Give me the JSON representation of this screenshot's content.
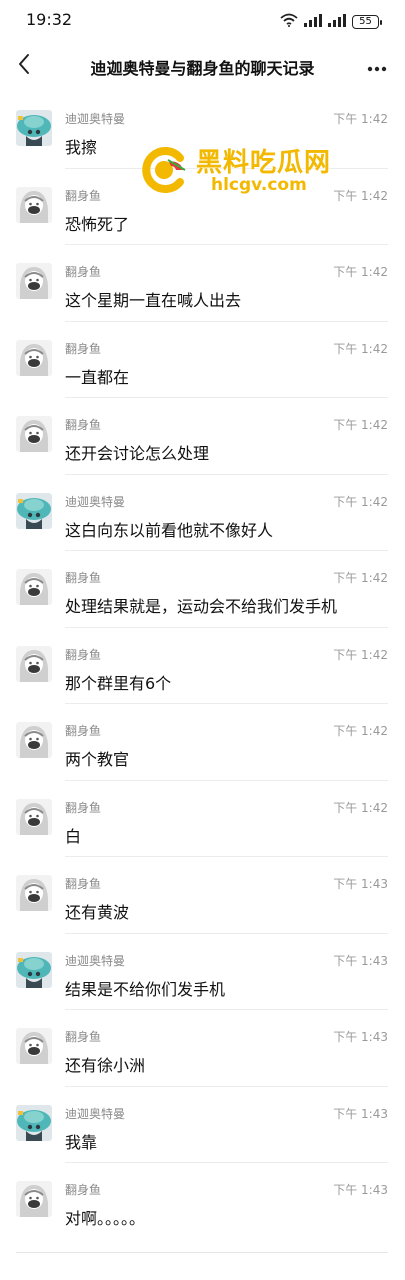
{
  "status_bar": {
    "time": "19:32",
    "battery": "55",
    "icons": [
      "wifi-icon",
      "signal-icon",
      "signal-icon",
      "battery-icon"
    ]
  },
  "header": {
    "title": "迪迦奥特曼与翻身鱼的聊天记录",
    "back_icon": "chevron-left-icon",
    "more_icon": "more-dots-icon"
  },
  "watermark": {
    "title": "黑料吃瓜网",
    "url": "hlcgv.com",
    "color": "#f3b800"
  },
  "messages": [
    {
      "sender": "迪迦奥特曼",
      "avatar": "teal",
      "time": "下午 1:42",
      "text": "我擦"
    },
    {
      "sender": "翻身鱼",
      "avatar": "gray",
      "time": "下午 1:42",
      "text": "恐怖死了"
    },
    {
      "sender": "翻身鱼",
      "avatar": "gray",
      "time": "下午 1:42",
      "text": "这个星期一直在喊人出去"
    },
    {
      "sender": "翻身鱼",
      "avatar": "gray",
      "time": "下午 1:42",
      "text": "一直都在"
    },
    {
      "sender": "翻身鱼",
      "avatar": "gray",
      "time": "下午 1:42",
      "text": "还开会讨论怎么处理"
    },
    {
      "sender": "迪迦奥特曼",
      "avatar": "teal",
      "time": "下午 1:42",
      "text": "这白向东以前看他就不像好人"
    },
    {
      "sender": "翻身鱼",
      "avatar": "gray",
      "time": "下午 1:42",
      "text": "处理结果就是，运动会不给我们发手机"
    },
    {
      "sender": "翻身鱼",
      "avatar": "gray",
      "time": "下午 1:42",
      "text": "那个群里有6个"
    },
    {
      "sender": "翻身鱼",
      "avatar": "gray",
      "time": "下午 1:42",
      "text": "两个教官"
    },
    {
      "sender": "翻身鱼",
      "avatar": "gray",
      "time": "下午 1:42",
      "text": "白"
    },
    {
      "sender": "翻身鱼",
      "avatar": "gray",
      "time": "下午 1:43",
      "text": "还有黄波"
    },
    {
      "sender": "迪迦奥特曼",
      "avatar": "teal",
      "time": "下午 1:43",
      "text": "结果是不给你们发手机"
    },
    {
      "sender": "翻身鱼",
      "avatar": "gray",
      "time": "下午 1:43",
      "text": "还有徐小洲"
    },
    {
      "sender": "迪迦奥特曼",
      "avatar": "teal",
      "time": "下午 1:43",
      "text": "我靠"
    },
    {
      "sender": "翻身鱼",
      "avatar": "gray",
      "time": "下午 1:43",
      "text": "对啊。。。。。"
    }
  ]
}
